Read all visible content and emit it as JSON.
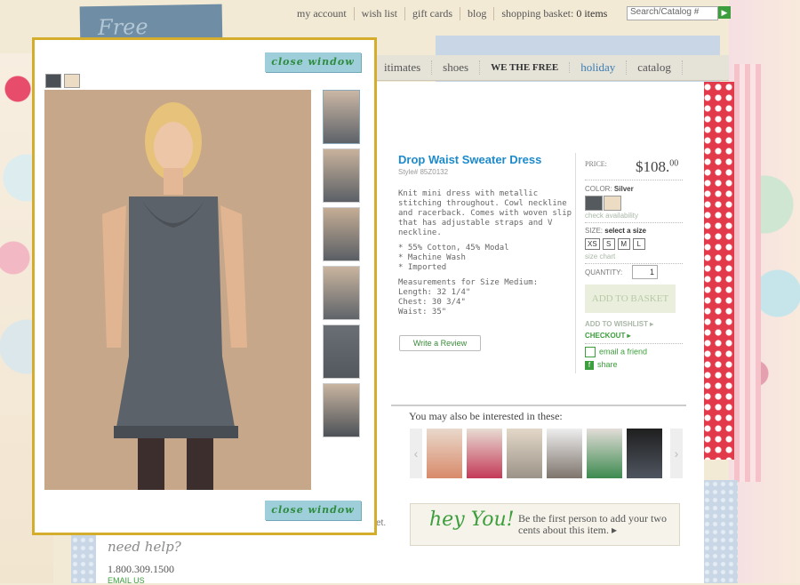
{
  "topnav": {
    "links": [
      "my account",
      "wish list",
      "gift cards",
      "blog"
    ],
    "basket_label": "shopping basket:",
    "basket_count": "0 items",
    "search_placeholder": "Search/Catalog #"
  },
  "category_tabs": [
    "itimates",
    "shoes",
    "WE THE FREE",
    "holiday",
    "catalog"
  ],
  "product": {
    "title": "Drop Waist Sweater Dress",
    "style": "Style# 85Z0132",
    "description": "Knit mini dress with metallic stitching throughout. Cowl neckline and racerback. Comes with woven slip that has adjustable straps and V neckline.",
    "features": [
      "* 55% Cotton, 45% Modal",
      "* Machine Wash",
      "* Imported"
    ],
    "measurements_title": "Measurements for Size Medium:",
    "measurements": [
      "Length: 32 1/4\"",
      "Chest: 30 3/4\"",
      "Waist: 35\""
    ],
    "write_review": "Write a Review"
  },
  "buy": {
    "price_label": "PRICE:",
    "price_main": "$108.",
    "price_cents": "00",
    "color_label": "COLOR:",
    "color_value": "Silver",
    "check_availability": "check availability",
    "size_label": "SIZE:",
    "size_prompt": "select a size",
    "sizes": [
      "XS",
      "S",
      "M",
      "L"
    ],
    "size_chart": "size chart",
    "quantity_label": "QUANTITY:",
    "quantity": "1",
    "add_to_basket": "ADD TO BASKET",
    "add_to_wishlist": "ADD TO WISHLIST ▸",
    "checkout": "CHECKOUT ▸",
    "email_friend": "email a friend",
    "share": "share",
    "swatch_colors": [
      "#555a5f",
      "#ecdcc3"
    ]
  },
  "interested": {
    "title": "You may also be interested in these:"
  },
  "heyyou": {
    "headline": "hey You!",
    "text": "Be the first person to add your two cents about this item. ▸"
  },
  "help": {
    "title": "need help?",
    "phone": "1.800.309.1500",
    "email": "EMAIL US"
  },
  "snippet": "et.",
  "popup": {
    "close_label": "close window",
    "accent": "#d5ad2d"
  }
}
